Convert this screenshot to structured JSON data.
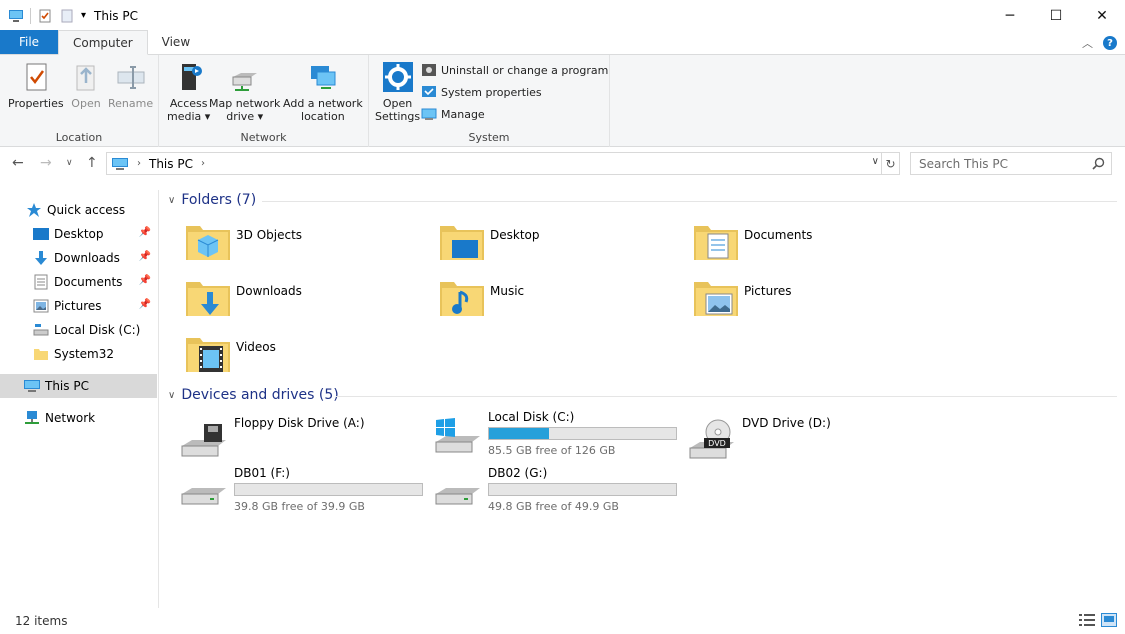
{
  "window": {
    "title": "This PC",
    "controls": [
      "minimize",
      "maximize",
      "close"
    ]
  },
  "ribbon": {
    "tabs": [
      {
        "label": "File"
      },
      {
        "label": "Computer"
      },
      {
        "label": "View"
      }
    ],
    "groups": {
      "location": {
        "label": "Location",
        "buttons": [
          {
            "label": "Properties"
          },
          {
            "label": "Open"
          },
          {
            "label": "Rename"
          }
        ]
      },
      "network": {
        "label": "Network",
        "buttons": [
          {
            "line1": "Access",
            "line2": "media"
          },
          {
            "line1": "Map network",
            "line2": "drive"
          },
          {
            "line1": "Add a network",
            "line2": "location"
          }
        ]
      },
      "system": {
        "label": "System",
        "open_settings": {
          "line1": "Open",
          "line2": "Settings"
        },
        "items": [
          {
            "label": "Uninstall or change a program"
          },
          {
            "label": "System properties"
          },
          {
            "label": "Manage"
          }
        ]
      }
    }
  },
  "address": {
    "crumb": "This PC",
    "search_placeholder": "Search This PC"
  },
  "nav": {
    "quick_access": "Quick access",
    "items": [
      {
        "label": "Desktop"
      },
      {
        "label": "Downloads"
      },
      {
        "label": "Documents"
      },
      {
        "label": "Pictures"
      },
      {
        "label": "Local Disk (C:)"
      },
      {
        "label": "System32"
      }
    ],
    "this_pc": "This PC",
    "network": "Network"
  },
  "folders": {
    "header": "Folders (7)",
    "items": [
      {
        "label": "3D Objects"
      },
      {
        "label": "Desktop"
      },
      {
        "label": "Documents"
      },
      {
        "label": "Downloads"
      },
      {
        "label": "Music"
      },
      {
        "label": "Pictures"
      },
      {
        "label": "Videos"
      }
    ]
  },
  "devices": {
    "header": "Devices and drives (5)",
    "items": [
      {
        "label": "Floppy Disk Drive (A:)"
      },
      {
        "label": "Local Disk (C:)",
        "free": "85.5 GB free of 126 GB",
        "used_fraction": 0.32
      },
      {
        "label": "DVD Drive (D:)"
      },
      {
        "label": "DB01 (F:)",
        "free": "39.8 GB free of 39.9 GB",
        "used_fraction": 0.0
      },
      {
        "label": "DB02 (G:)",
        "free": "49.8 GB free of 49.9 GB",
        "used_fraction": 0.0
      }
    ]
  },
  "status": {
    "items": "12 items"
  },
  "colors": {
    "accent": "#1979ca",
    "section_header": "#1e3287",
    "bar_fill": "#26a0da",
    "folder": "#f8d775"
  }
}
